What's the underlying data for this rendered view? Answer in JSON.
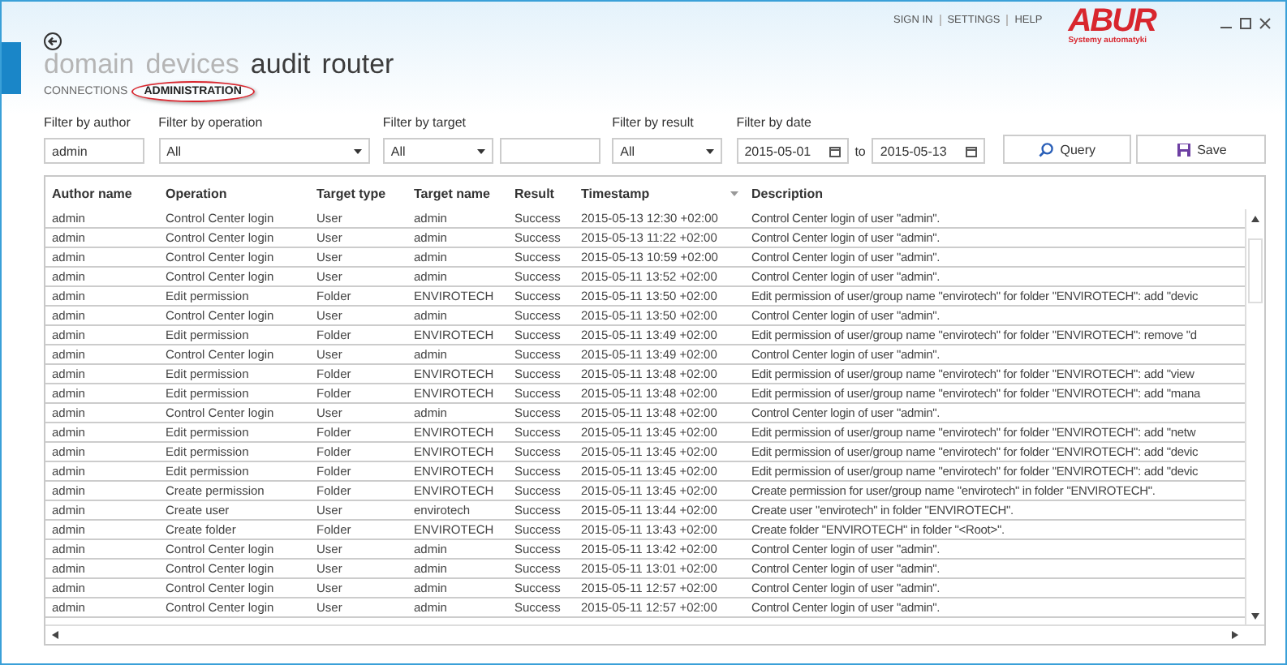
{
  "top_links": [
    "SIGN IN",
    "SETTINGS",
    "HELP"
  ],
  "logo": {
    "name": "ABUR",
    "tagline": "Systemy automatyki"
  },
  "nav": [
    {
      "label": "domain",
      "dimmed": true
    },
    {
      "label": "devices",
      "dimmed": true
    },
    {
      "label": "audit",
      "dimmed": false
    },
    {
      "label": "router",
      "dimmed": false
    }
  ],
  "subtabs": [
    {
      "label": "CONNECTIONS",
      "selected": false
    },
    {
      "label": "ADMINISTRATION",
      "selected": true
    }
  ],
  "filters": {
    "author": {
      "label": "Filter by author",
      "value": "admin"
    },
    "operation": {
      "label": "Filter by operation",
      "value": "All"
    },
    "target": {
      "label": "Filter by target",
      "value": "All"
    },
    "result": {
      "label": "Filter by result",
      "value": "All"
    },
    "date": {
      "label": "Filter by date",
      "from": "2015-05-01",
      "separator": "to",
      "to": "2015-05-13"
    }
  },
  "buttons": [
    {
      "kind": "query",
      "label": "Query"
    },
    {
      "kind": "save",
      "label": "Save"
    }
  ],
  "table": {
    "columns": [
      {
        "label": "Author name",
        "sorted": false
      },
      {
        "label": "Operation",
        "sorted": false
      },
      {
        "label": "Target type",
        "sorted": false
      },
      {
        "label": "Target name",
        "sorted": false
      },
      {
        "label": "Result",
        "sorted": false
      },
      {
        "label": "Timestamp",
        "sorted": true
      },
      {
        "label": "Description",
        "sorted": false
      }
    ],
    "rows": [
      [
        "admin",
        "Control Center login",
        "User",
        "admin",
        "Success",
        "2015-05-13 12:30 +02:00",
        "Control Center login of user \"admin\"."
      ],
      [
        "admin",
        "Control Center login",
        "User",
        "admin",
        "Success",
        "2015-05-13 11:22 +02:00",
        "Control Center login of user \"admin\"."
      ],
      [
        "admin",
        "Control Center login",
        "User",
        "admin",
        "Success",
        "2015-05-13 10:59 +02:00",
        "Control Center login of user \"admin\"."
      ],
      [
        "admin",
        "Control Center login",
        "User",
        "admin",
        "Success",
        "2015-05-11 13:52 +02:00",
        "Control Center login of user \"admin\"."
      ],
      [
        "admin",
        "Edit permission",
        "Folder",
        "ENVIROTECH",
        "Success",
        "2015-05-11 13:50 +02:00",
        "Edit permission of user/group name \"envirotech\" for folder \"ENVIROTECH\": add \"devic"
      ],
      [
        "admin",
        "Control Center login",
        "User",
        "admin",
        "Success",
        "2015-05-11 13:50 +02:00",
        "Control Center login of user \"admin\"."
      ],
      [
        "admin",
        "Edit permission",
        "Folder",
        "ENVIROTECH",
        "Success",
        "2015-05-11 13:49 +02:00",
        "Edit permission of user/group name \"envirotech\" for folder \"ENVIROTECH\": remove \"d"
      ],
      [
        "admin",
        "Control Center login",
        "User",
        "admin",
        "Success",
        "2015-05-11 13:49 +02:00",
        "Control Center login of user \"admin\"."
      ],
      [
        "admin",
        "Edit permission",
        "Folder",
        "ENVIROTECH",
        "Success",
        "2015-05-11 13:48 +02:00",
        "Edit permission of user/group name \"envirotech\" for folder \"ENVIROTECH\": add \"view"
      ],
      [
        "admin",
        "Edit permission",
        "Folder",
        "ENVIROTECH",
        "Success",
        "2015-05-11 13:48 +02:00",
        "Edit permission of user/group name \"envirotech\" for folder \"ENVIROTECH\": add \"mana"
      ],
      [
        "admin",
        "Control Center login",
        "User",
        "admin",
        "Success",
        "2015-05-11 13:48 +02:00",
        "Control Center login of user \"admin\"."
      ],
      [
        "admin",
        "Edit permission",
        "Folder",
        "ENVIROTECH",
        "Success",
        "2015-05-11 13:45 +02:00",
        "Edit permission of user/group name \"envirotech\" for folder \"ENVIROTECH\": add \"netw"
      ],
      [
        "admin",
        "Edit permission",
        "Folder",
        "ENVIROTECH",
        "Success",
        "2015-05-11 13:45 +02:00",
        "Edit permission of user/group name \"envirotech\" for folder \"ENVIROTECH\": add \"devic"
      ],
      [
        "admin",
        "Edit permission",
        "Folder",
        "ENVIROTECH",
        "Success",
        "2015-05-11 13:45 +02:00",
        "Edit permission of user/group name \"envirotech\" for folder \"ENVIROTECH\": add \"devic"
      ],
      [
        "admin",
        "Create permission",
        "Folder",
        "ENVIROTECH",
        "Success",
        "2015-05-11 13:45 +02:00",
        "Create permission for user/group name \"envirotech\" in folder \"ENVIROTECH\"."
      ],
      [
        "admin",
        "Create user",
        "User",
        "envirotech",
        "Success",
        "2015-05-11 13:44 +02:00",
        "Create user \"envirotech\" in folder \"ENVIROTECH\"."
      ],
      [
        "admin",
        "Create folder",
        "Folder",
        "ENVIROTECH",
        "Success",
        "2015-05-11 13:43 +02:00",
        "Create folder \"ENVIROTECH\" in folder \"<Root>\"."
      ],
      [
        "admin",
        "Control Center login",
        "User",
        "admin",
        "Success",
        "2015-05-11 13:42 +02:00",
        "Control Center login of user \"admin\"."
      ],
      [
        "admin",
        "Control Center login",
        "User",
        "admin",
        "Success",
        "2015-05-11 13:01 +02:00",
        "Control Center login of user \"admin\"."
      ],
      [
        "admin",
        "Control Center login",
        "User",
        "admin",
        "Success",
        "2015-05-11 12:57 +02:00",
        "Control Center login of user \"admin\"."
      ],
      [
        "admin",
        "Control Center login",
        "User",
        "admin",
        "Success",
        "2015-05-11 12:57 +02:00",
        "Control Center login of user \"admin\"."
      ]
    ]
  }
}
